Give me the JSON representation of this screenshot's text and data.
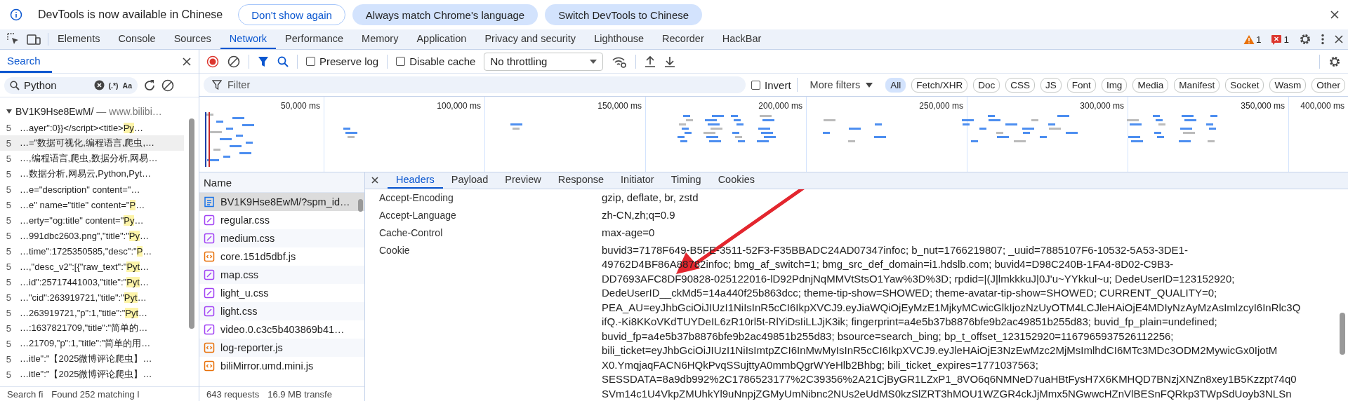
{
  "infobar": {
    "message": "DevTools is now available in Chinese",
    "buttons": [
      {
        "label": "Don't show again",
        "kind": "outlined"
      },
      {
        "label": "Always match Chrome's language",
        "kind": "filled"
      },
      {
        "label": "Switch DevTools to Chinese",
        "kind": "filled"
      }
    ]
  },
  "main_tabs": [
    {
      "label": "Elements",
      "selected": false
    },
    {
      "label": "Console",
      "selected": false
    },
    {
      "label": "Sources",
      "selected": false
    },
    {
      "label": "Network",
      "selected": true
    },
    {
      "label": "Performance",
      "selected": false
    },
    {
      "label": "Memory",
      "selected": false
    },
    {
      "label": "Application",
      "selected": false
    },
    {
      "label": "Privacy and security",
      "selected": false
    },
    {
      "label": "Lighthouse",
      "selected": false
    },
    {
      "label": "Recorder",
      "selected": false
    },
    {
      "label": "HackBar",
      "selected": false
    }
  ],
  "issues": {
    "warnings": "1",
    "errors": "1"
  },
  "search_panel": {
    "tab": {
      "label": "Search",
      "selected": true
    },
    "query": "Python",
    "regex_label": "(.*)",
    "case_label": "Aa",
    "results": [
      {
        "file": "BV1K9Hse8EwM/",
        "separator": "—",
        "domain": "www.bilibi…",
        "expanded": true,
        "children": [
          {
            "line": "5",
            "before": "…ayer\":0}}</script><title>",
            "match": "Py",
            "after": "…",
            "selected": false
          },
          {
            "line": "5",
            "before": "…=\"数据可视化,编程语言,爬虫,…",
            "selected": true
          },
          {
            "line": "5",
            "before": "…,编程语言,爬虫,数据分析,网易…",
            "selected": false
          },
          {
            "line": "5",
            "before": "…数据分析,网易云,Python,Pyt…",
            "selected": false
          },
          {
            "line": "5",
            "before": "…e=\"description\" content=\"…",
            "selected": false
          },
          {
            "line": "5",
            "before": "…e\" name=\"title\" content=\"",
            "match": "P",
            "after": "…",
            "selected": false
          },
          {
            "line": "5",
            "before": "…erty=\"og:title\" content=\"",
            "match": "Py",
            "after": "…",
            "selected": false
          },
          {
            "line": "5",
            "before": "…991dbc2603.png\",\"title\":\"",
            "match": "Py",
            "after": "…",
            "selected": false
          },
          {
            "line": "5",
            "before": "…time\":1725350585,\"desc\":\"",
            "match": "P",
            "after": "…",
            "selected": false
          },
          {
            "line": "5",
            "before": "…,\"desc_v2\":[{\"raw_text\":\"",
            "match": "Pyt",
            "after": "…",
            "selected": false
          },
          {
            "line": "5",
            "before": "…id\":25717441003,\"title\":\"",
            "match": "Pyt",
            "after": "…",
            "selected": false
          },
          {
            "line": "5",
            "before": "…\"cid\":263919721,\"title\":\"",
            "match": "Pyt",
            "after": "…",
            "selected": false
          },
          {
            "line": "5",
            "before": "…263919721,\"p\":1,\"title\":\"",
            "match": "Pyt",
            "after": "…",
            "selected": false
          },
          {
            "line": "5",
            "before": "…:1637821709,\"title\":\"简单的…",
            "selected": false
          },
          {
            "line": "5",
            "before": "…21709,\"p\":1,\"title\":\"简单的用…",
            "selected": false
          },
          {
            "line": "5",
            "before": "…itle\":\"【2025微博评论爬虫】…",
            "selected": false
          },
          {
            "line": "5",
            "before": "…itle\":\"【2025微博评论爬虫】…",
            "selected": false
          }
        ]
      }
    ],
    "status": [
      "Search fi",
      "Found 252 matching l"
    ]
  },
  "network_toolbar": {
    "preserve_log": {
      "label": "Preserve log",
      "checked": false
    },
    "disable_cache": {
      "label": "Disable cache",
      "checked": false
    },
    "throttling": "No throttling"
  },
  "filter_bar": {
    "placeholder": "Filter",
    "invert": {
      "label": "Invert",
      "checked": false
    },
    "more_filters": "More filters",
    "types": [
      {
        "label": "All",
        "selected": true
      },
      {
        "label": "Fetch/XHR",
        "selected": false
      },
      {
        "label": "Doc",
        "selected": false
      },
      {
        "label": "CSS",
        "selected": false
      },
      {
        "label": "JS",
        "selected": false
      },
      {
        "label": "Font",
        "selected": false
      },
      {
        "label": "Img",
        "selected": false
      },
      {
        "label": "Media",
        "selected": false
      },
      {
        "label": "Manifest",
        "selected": false
      },
      {
        "label": "Socket",
        "selected": false
      },
      {
        "label": "Wasm",
        "selected": false
      },
      {
        "label": "Other",
        "selected": false
      }
    ]
  },
  "timeline": {
    "ticks": [
      "50,000 ms",
      "100,000 ms",
      "150,000 ms",
      "200,000 ms",
      "250,000 ms",
      "300,000 ms",
      "350,000 ms",
      "400,000 ms"
    ]
  },
  "requests": {
    "column": "Name",
    "rows": [
      {
        "name": "BV1K9Hse8EwM/?spm_id…",
        "kind": "document",
        "selected": true
      },
      {
        "name": "regular.css",
        "kind": "stylesheet",
        "selected": false
      },
      {
        "name": "medium.css",
        "kind": "stylesheet",
        "selected": false
      },
      {
        "name": "core.151d5dbf.js",
        "kind": "script",
        "selected": false
      },
      {
        "name": "map.css",
        "kind": "stylesheet",
        "selected": false
      },
      {
        "name": "light_u.css",
        "kind": "stylesheet",
        "selected": false
      },
      {
        "name": "light.css",
        "kind": "stylesheet",
        "selected": false
      },
      {
        "name": "video.0.c3c5b403869b41…",
        "kind": "stylesheet",
        "selected": false
      },
      {
        "name": "log-reporter.js",
        "kind": "script",
        "selected": false
      },
      {
        "name": "biliMirror.umd.mini.js",
        "kind": "script",
        "selected": false
      }
    ],
    "status": [
      "643 requests",
      "16.9 MB transfe"
    ]
  },
  "details": {
    "tabs": [
      {
        "label": "Headers",
        "selected": true
      },
      {
        "label": "Payload",
        "selected": false
      },
      {
        "label": "Preview",
        "selected": false
      },
      {
        "label": "Response",
        "selected": false
      },
      {
        "label": "Initiator",
        "selected": false
      },
      {
        "label": "Timing",
        "selected": false
      },
      {
        "label": "Cookies",
        "selected": false
      }
    ],
    "headers": [
      {
        "name": "Accept-Encoding",
        "value": [
          "gzip, deflate, br, zstd"
        ]
      },
      {
        "name": "Accept-Language",
        "value": [
          "zh-CN,zh;q=0.9"
        ]
      },
      {
        "name": "Cache-Control",
        "value": [
          "max-age=0"
        ]
      },
      {
        "name": "Cookie",
        "value": [
          "buvid3=7178F649-B5FE-3511-52F3-F35BBADC24AD07347infoc; b_nut=1766219807; _uuid=7885107F6-10532-5A53-3DE1-",
          "49762D4BF86A88782infoc; bmg_af_switch=1; bmg_src_def_domain=i1.hdslb.com; buvid4=D98C240B-1FA4-8D02-C9B3-",
          "DD7693AFC8DF90828-025122016-lD92PdnjNqMMVtStsO1Yaw%3D%3D; rpdid=|(J|lmkkkuJ|0J'u~YYkkul~u; DedeUserID=123152920;",
          "DedeUserID__ckMd5=14a440f25b863dcc; theme-tip-show=SHOWED; theme-avatar-tip-show=SHOWED; CURRENT_QUALITY=0;",
          "PEA_AU=eyJhbGciOiJIUzI1NiIsInR5cCI6IkpXVCJ9.eyJiaWQiOjEyMzE1MjkyMCwicGlkIjozNzUyOTM4LCJleHAiOjE4MDIyNzAyMzAsImlzcyI6InRlc3Q",
          "ifQ.-Ki8KKoVKdTUYDeIL6zR10rl5t-RlYiDsIiLLJjK3ik; fingerprint=a4e5b37b8876bfe9b2ac49851b255d83; buvid_fp_plain=undefined;",
          "buvid_fp=a4e5b37b8876bfe9b2ac49851b255d83; bsource=search_bing; bp_t_offset_123152920=1167965937526112256;",
          "bili_ticket=eyJhbGciOiJIUzI1NiIsImtpZCI6InMwMyIsInR5cCI6IkpXVCJ9.eyJleHAiOjE3NzEwMzc2MjMsImlhdCI6MTc3MDc3ODM2MywicGx0IjotM",
          "X0.YmqjaqFACN6HQkPvqSSujttyA0mmbQgrWYeHlb2Bhbg; bili_ticket_expires=1771037563;",
          "SESSDATA=8a9db992%2C1786523177%2C39356%2A21CjByGR1LZxP1_8VO6q6NMNeD7uaHBtFysH7X6KMHQD7BNzjXNZn8xey1B5Kzzpt74q0",
          "SVm14c1U4VkpZMUhkYl9uNnpjZGMyUmNibnc2NUs2eUdMS0kzSlZRT3hMOU1WZGR4ckJjMmx5NGwwcHZnVlBESnFQRkp3TWpSdUoyb3NLSn"
        ]
      }
    ]
  }
}
